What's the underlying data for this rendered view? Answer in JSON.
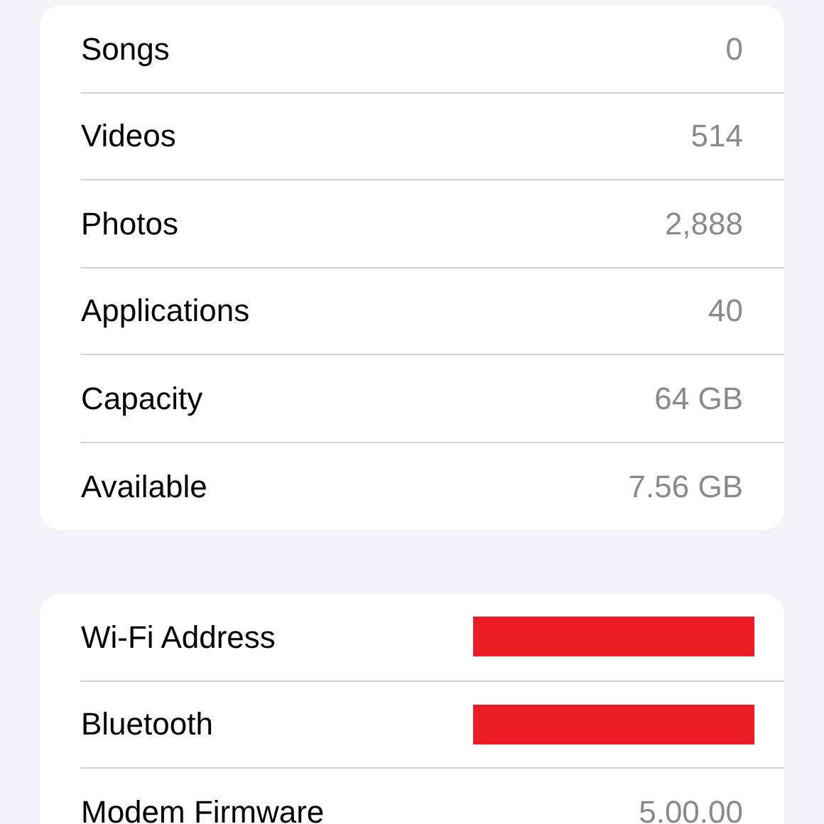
{
  "sections": [
    {
      "rows": [
        {
          "label": "Songs",
          "value": "0"
        },
        {
          "label": "Videos",
          "value": "514"
        },
        {
          "label": "Photos",
          "value": "2,888"
        },
        {
          "label": "Applications",
          "value": "40"
        },
        {
          "label": "Capacity",
          "value": "64 GB"
        },
        {
          "label": "Available",
          "value": "7.56 GB"
        }
      ]
    },
    {
      "rows": [
        {
          "label": "Wi-Fi Address",
          "redacted": true
        },
        {
          "label": "Bluetooth",
          "redacted": true
        },
        {
          "label": "Modem Firmware",
          "value": "5.00.00"
        }
      ]
    }
  ]
}
